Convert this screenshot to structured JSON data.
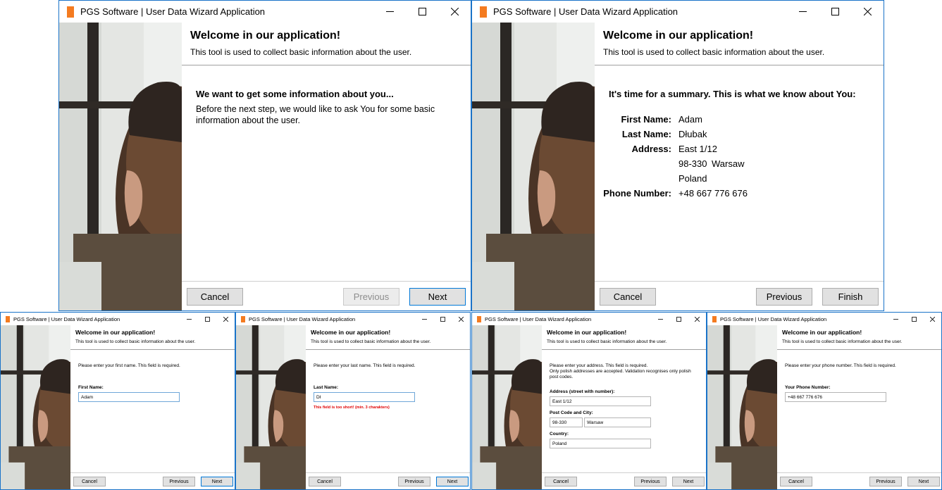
{
  "app": {
    "title": "PGS Software | User Data Wizard Application"
  },
  "header": {
    "title": "Welcome in our application!",
    "subtitle": "This tool is used to collect basic information about the user."
  },
  "buttons": {
    "cancel": "Cancel",
    "previous": "Previous",
    "next": "Next",
    "finish": "Finish"
  },
  "intro": {
    "heading": "We want to get some information about you...",
    "line1": "Before the next step, we would like to ask You for some basic",
    "line2": "information about the user."
  },
  "summary": {
    "heading": "It's time for a summary. This is what we know about You:",
    "first_name_label": "First Name:",
    "first_name": "Adam",
    "last_name_label": "Last Name:",
    "last_name": "Dłubak",
    "address_label": "Address:",
    "address_line1": "East 1/12",
    "address_line2": "98-330",
    "address_city": "Warsaw",
    "address_line3": "Poland",
    "phone_label": "Phone Number:",
    "phone": "+48 667 776 676"
  },
  "step_first": {
    "instruction": "Please enter your first name. This field is required.",
    "label": "First Name:",
    "value": "Adam"
  },
  "step_last": {
    "instruction": "Please enter your last name. This field is required.",
    "label": "Last Name:",
    "value": "Dł",
    "error": "This field is too short! (min. 3 charakters)"
  },
  "step_address": {
    "instruction1": "Please enter your address. This field is required.",
    "instruction2": "Only polish addresses are accepted. Validation recognises only polish",
    "instruction3": "post codes.",
    "street_label": "Address (street with number):",
    "street_value": "East 1/12",
    "postcode_label": "Post Code and City:",
    "postcode_value": "98-330",
    "city_value": "Warsaw",
    "country_label": "Country:",
    "country_value": "Poland"
  },
  "step_phone": {
    "instruction": "Please enter your phone number. This field is required.",
    "label": "Your Phone Number:",
    "value": "+48 667 776 676"
  },
  "icons": {
    "app": "app-logo-icon",
    "minimize": "minimize-icon",
    "maximize": "maximize-icon",
    "close": "close-icon"
  },
  "colors": {
    "brand_orange": "#f47b20",
    "window_border": "#1a73c8",
    "error_red": "#e00000",
    "primary_border": "#0078d7"
  }
}
